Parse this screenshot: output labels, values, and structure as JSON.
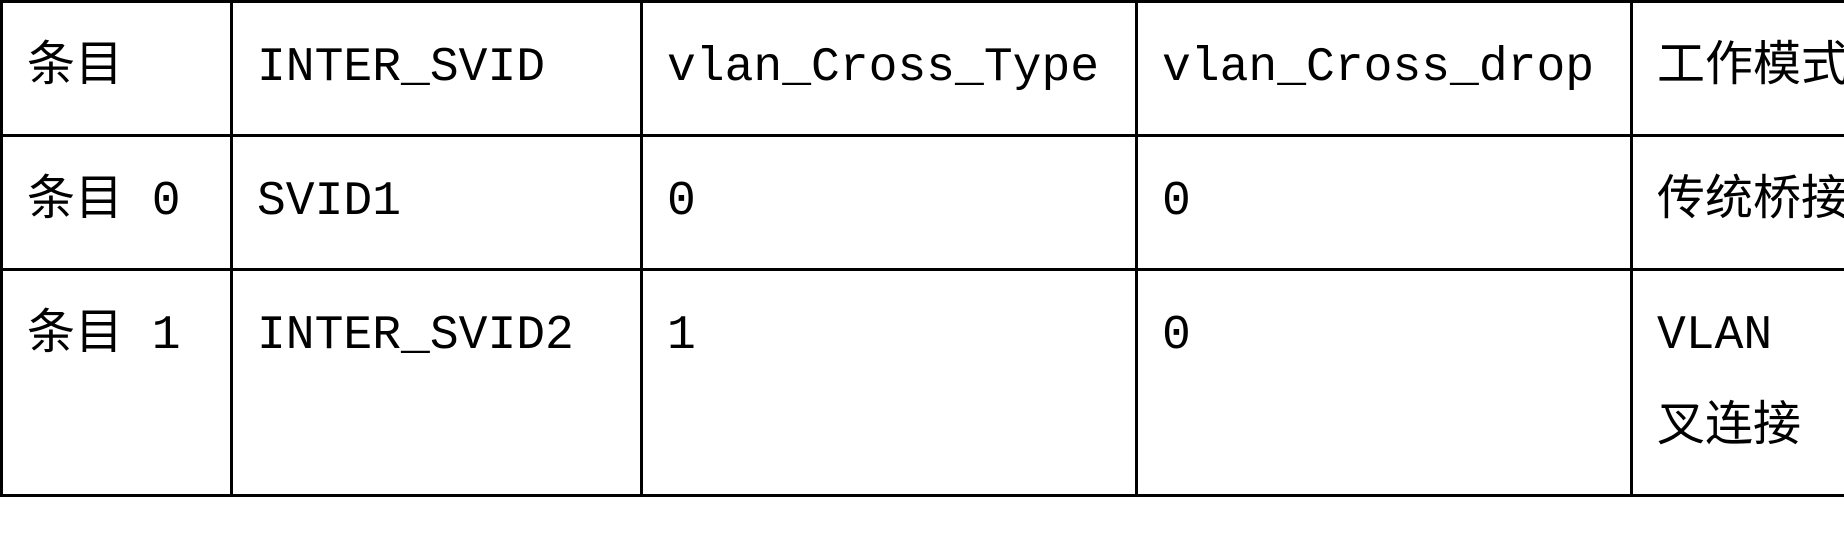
{
  "table": {
    "headers": {
      "col0": "条目",
      "col1": "INTER_SVID",
      "col2": "vlan_Cross_Type",
      "col3": "vlan_Cross_drop",
      "col4": "工作模式"
    },
    "rows": [
      {
        "col0": "条目 0",
        "col1": "SVID1",
        "col2": "0",
        "col3": "0",
        "col4": "传统桥接"
      },
      {
        "col0": "条目 1",
        "col1": "INTER_SVID2",
        "col2": "1",
        "col3": "0",
        "col4_line1": "VLAN 交",
        "col4_line2": "叉连接"
      }
    ]
  }
}
